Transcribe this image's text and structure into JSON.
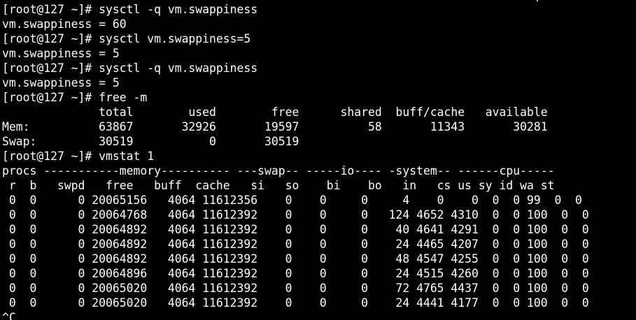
{
  "terminal": {
    "colors": {
      "background": "#000000",
      "foreground": "#ffffff"
    },
    "lines": [
      "[root@127 ~]# sysctl -q vm.swappiness",
      "vm.swappiness = 60",
      "[root@127 ~]# sysctl vm.swappiness=5",
      "vm.swappiness = 5",
      "[root@127 ~]# sysctl -q vm.swappiness",
      "vm.swappiness = 5",
      "[root@127 ~]# free -m",
      "              total        used        free      shared  buff/cache   available",
      "Mem:          63867       32926       19597          58       11343       30281",
      "Swap:         30519           0       30519",
      "[root@127 ~]# vmstat 1",
      "procs -----------memory---------- ---swap-- -----io---- -system-- ------cpu-----",
      " r  b   swpd   free   buff  cache   si   so    bi    bo   in   cs us sy id wa st",
      " 0  0      0 20065156   4064 11612356    0    0     0     4    0    0  0  0 99  0  0",
      " 0  0      0 20064768   4064 11612392    0    0     0   124 4652 4310  0  0 100  0  0",
      " 0  0      0 20064892   4064 11612392    0    0     0    40 4641 4291  0  0 100  0  0",
      " 0  0      0 20064892   4064 11612392    0    0     0    24 4465 4207  0  0 100  0  0",
      " 0  0      0 20064892   4064 11612392    0    0     0    48 4547 4255  0  0 100  0  0",
      " 0  0      0 20064896   4064 11612392    0    0     0    24 4515 4260  0  0 100  0  0",
      " 0  0      0 20065020   4064 11612392    0    0     0    72 4765 4437  0  0 100  0  0",
      " 0  0      0 20065020   4064 11612392    0    0     0    24 4441 4177  0  0 100  0  0",
      "^C"
    ],
    "top_clip": "’,"
  }
}
